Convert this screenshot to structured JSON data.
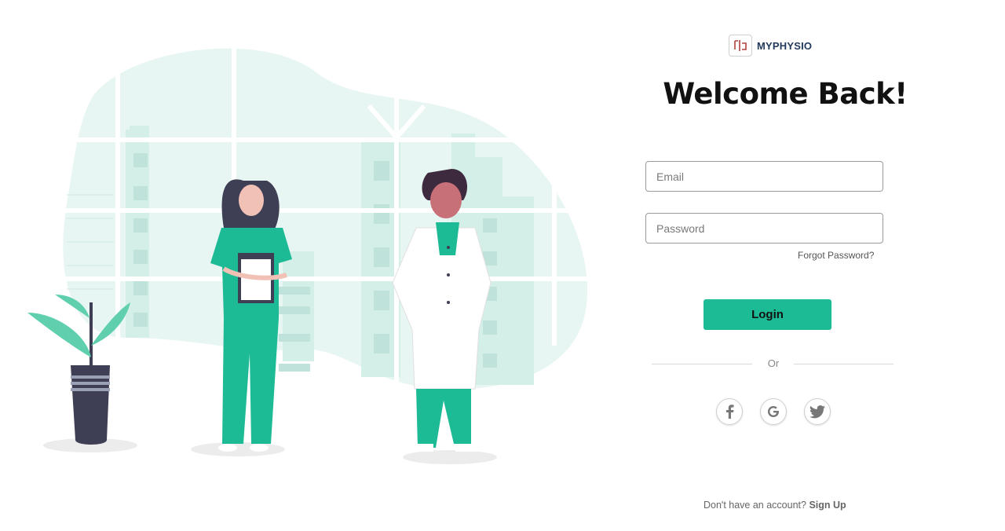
{
  "brand": {
    "name_prefix": "MY",
    "name_suffix": "PHYSIO"
  },
  "heading": "Welcome Back!",
  "form": {
    "email_placeholder": "Email",
    "password_placeholder": "Password",
    "forgot_password": "Forgot Password?",
    "login_label": "Login",
    "or_label": "Or"
  },
  "social": [
    {
      "name": "facebook-icon",
      "glyph": "f"
    },
    {
      "name": "google-icon",
      "glyph": "G"
    },
    {
      "name": "twitter-icon",
      "glyph": "bird"
    }
  ],
  "signup": {
    "prompt": "Don't have an account?",
    "link": "Sign Up"
  },
  "colors": {
    "accent": "#1dbb95",
    "brand_text": "#233a5c",
    "bg_blob": "#e8f6f3",
    "scrubs": "#1dbb95"
  }
}
